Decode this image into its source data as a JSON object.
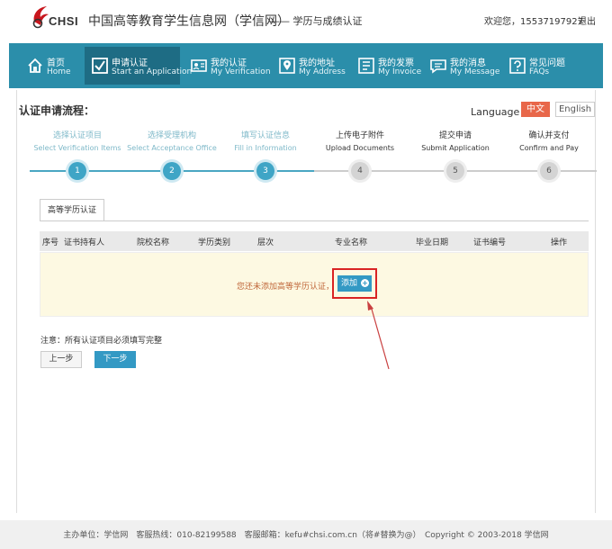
{
  "header": {
    "logo_text": "CHSI",
    "site_title": "中国高等教育学生信息网（学信网）",
    "site_subtitle": "—— 学历与成绩认证",
    "welcome": "欢迎您，15537197927",
    "logout": "退出"
  },
  "nav": [
    {
      "cn": "首页",
      "en": "Home",
      "icon": "home-icon"
    },
    {
      "cn": "申请认证",
      "en": "Start an Application",
      "icon": "checkbox-icon"
    },
    {
      "cn": "我的认证",
      "en": "My Verification",
      "icon": "id-card-icon"
    },
    {
      "cn": "我的地址",
      "en": "My Address",
      "icon": "location-icon"
    },
    {
      "cn": "我的发票",
      "en": "My Invoice",
      "icon": "invoice-icon"
    },
    {
      "cn": "我的消息",
      "en": "My Message",
      "icon": "message-icon"
    },
    {
      "cn": "常见问题",
      "en": "FAQs",
      "icon": "question-icon"
    }
  ],
  "flow": {
    "title": "认证申请流程：",
    "language_label": "Language：",
    "lang_zh": "中文",
    "lang_en": "English",
    "steps": [
      {
        "num": "1",
        "cn": "选择认证项目",
        "en": "Select Verification Items",
        "done": true
      },
      {
        "num": "2",
        "cn": "选择受理机构",
        "en": "Select Acceptance Office",
        "done": true
      },
      {
        "num": "3",
        "cn": "填写认证信息",
        "en": "Fill in Information",
        "done": true
      },
      {
        "num": "4",
        "cn": "上传电子附件",
        "en": "Upload Documents",
        "done": false
      },
      {
        "num": "5",
        "cn": "提交申请",
        "en": "Submit Application",
        "done": false
      },
      {
        "num": "6",
        "cn": "确认并支付",
        "en": "Confirm and Pay",
        "done": false
      }
    ]
  },
  "tab": {
    "label": "高等学历认证"
  },
  "table": {
    "columns": [
      "序号",
      "证书持有人",
      "院校名称",
      "学历类别",
      "层次",
      "专业名称",
      "毕业日期",
      "证书编号",
      "操作"
    ],
    "empty_text": "您还未添加高等学历认证，",
    "add_label": "添加"
  },
  "note": "注意：所有认证项目必须填写完整",
  "buttons": {
    "prev": "上一步",
    "next": "下一步"
  },
  "footer": "主办单位：学信网　客服热线：010-82199588　客服邮箱：kefu#chsi.com.cn（将#替换为@）　Copyright © 2003-2018 学信网",
  "colors": {
    "nav": "#2b8eaa",
    "accent": "#3399c4",
    "highlight": "#d92424",
    "lang_active": "#e8674a"
  }
}
